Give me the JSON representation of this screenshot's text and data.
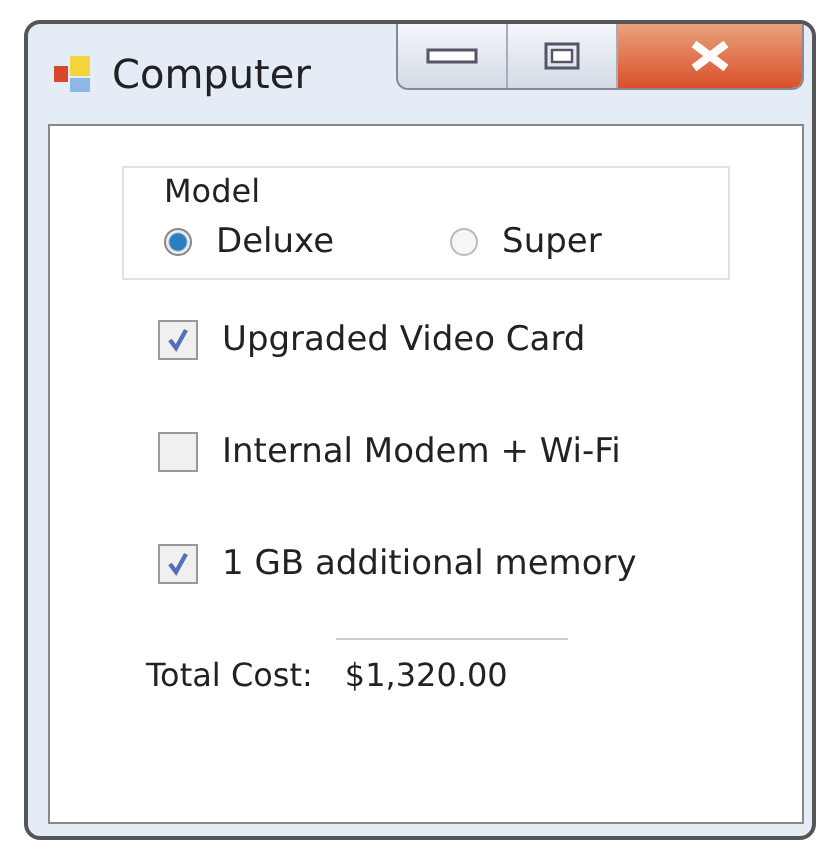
{
  "window": {
    "title": "Computer"
  },
  "model_group": {
    "title": "Model",
    "options": [
      {
        "label": "Deluxe",
        "selected": true
      },
      {
        "label": "Super",
        "selected": false
      }
    ]
  },
  "options": [
    {
      "label": "Upgraded Video Card",
      "checked": true
    },
    {
      "label": "Internal Modem + Wi-Fi",
      "checked": false
    },
    {
      "label": "1 GB additional memory",
      "checked": true
    }
  ],
  "total": {
    "label": "Total Cost:",
    "value": "$1,320.00"
  }
}
